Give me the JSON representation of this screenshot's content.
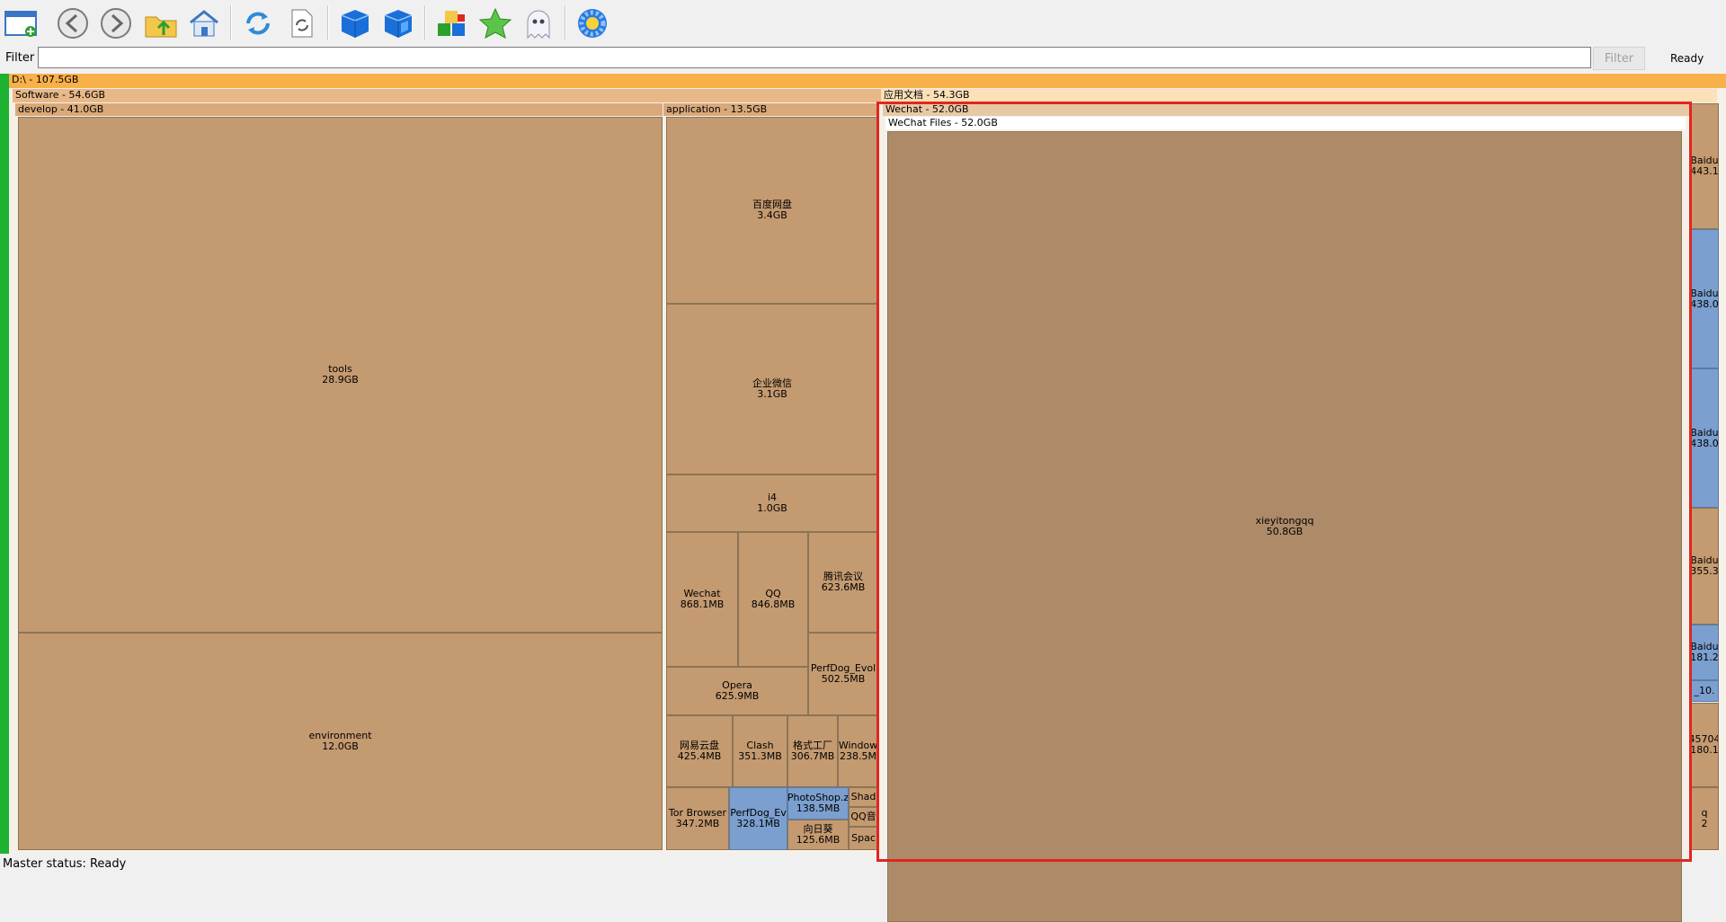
{
  "toolbar": {
    "buttons": [
      "new-window-icon",
      "back-icon",
      "forward-icon",
      "up-folder-icon",
      "home-icon",
      "refresh-icon",
      "refresh-page-icon",
      "cube-icon",
      "cube-alt-icon",
      "blocks-icon",
      "star-icon",
      "ghost-icon",
      "settings-gear-icon"
    ]
  },
  "filter": {
    "label": "Filter",
    "value": "",
    "button": "Filter",
    "status": "Ready"
  },
  "tree": {
    "root": "D:\\ - 107.5GB",
    "software": "Software - 54.6GB",
    "develop": "develop - 41.0GB",
    "application": "application - 13.5GB",
    "appdocs": "应用文档 - 54.3GB",
    "wechat": "Wechat - 52.0GB",
    "wechatfiles": "WeChat Files - 52.0GB",
    "tools": {
      "name": "tools",
      "size": "28.9GB"
    },
    "environment": {
      "name": "environment",
      "size": "12.0GB"
    },
    "apps": [
      {
        "name": "百度网盘",
        "size": "3.4GB"
      },
      {
        "name": "企业微信",
        "size": "3.1GB"
      },
      {
        "name": "i4",
        "size": "1.0GB"
      },
      {
        "name": "Wechat",
        "size": "868.1MB"
      },
      {
        "name": "QQ",
        "size": "846.8MB"
      },
      {
        "name": "腾讯会议",
        "size": "623.6MB"
      },
      {
        "name": "Opera",
        "size": "625.9MB"
      },
      {
        "name": "PerfDog_Evol",
        "size": "502.5MB"
      },
      {
        "name": "网易云盘",
        "size": "425.4MB"
      },
      {
        "name": "Clash",
        "size": "351.3MB"
      },
      {
        "name": "格式工厂",
        "size": "306.7MB"
      },
      {
        "name": "Window",
        "size": "238.5M"
      },
      {
        "name": "Tor Browser",
        "size": "347.2MB"
      },
      {
        "name": "PerfDog_Ev",
        "size": "328.1MB"
      },
      {
        "name": "PhotoShop.z",
        "size": "138.5MB"
      },
      {
        "name": "Shad",
        "size": ""
      },
      {
        "name": "QQ音",
        "size": ""
      },
      {
        "name": "向日葵",
        "size": "125.6MB"
      },
      {
        "name": "Spac",
        "size": ""
      }
    ],
    "xieyitongqq": {
      "name": "xieyitongqq",
      "size": "50.8GB"
    },
    "right_column": [
      {
        "name": "Baidu",
        "size": "443.1"
      },
      {
        "name": "Baidu",
        "size": "438.0"
      },
      {
        "name": "Baidu",
        "size": "438.0"
      },
      {
        "name": "Baidu",
        "size": "355.3"
      },
      {
        "name": "Baidu",
        "size": "181.2"
      },
      {
        "name": "_10.",
        "size": ""
      },
      {
        "name": "45704",
        "size": "180.1"
      },
      {
        "name": "q",
        "size": "2"
      }
    ]
  },
  "status": "Master status: Ready",
  "colors": {
    "tan": "#c49a70",
    "tan_dark": "#ad8b69",
    "blue": "#7b9fcf",
    "orange": "#f8b04a",
    "green": "#1db232",
    "highlight": "#e2251f"
  }
}
